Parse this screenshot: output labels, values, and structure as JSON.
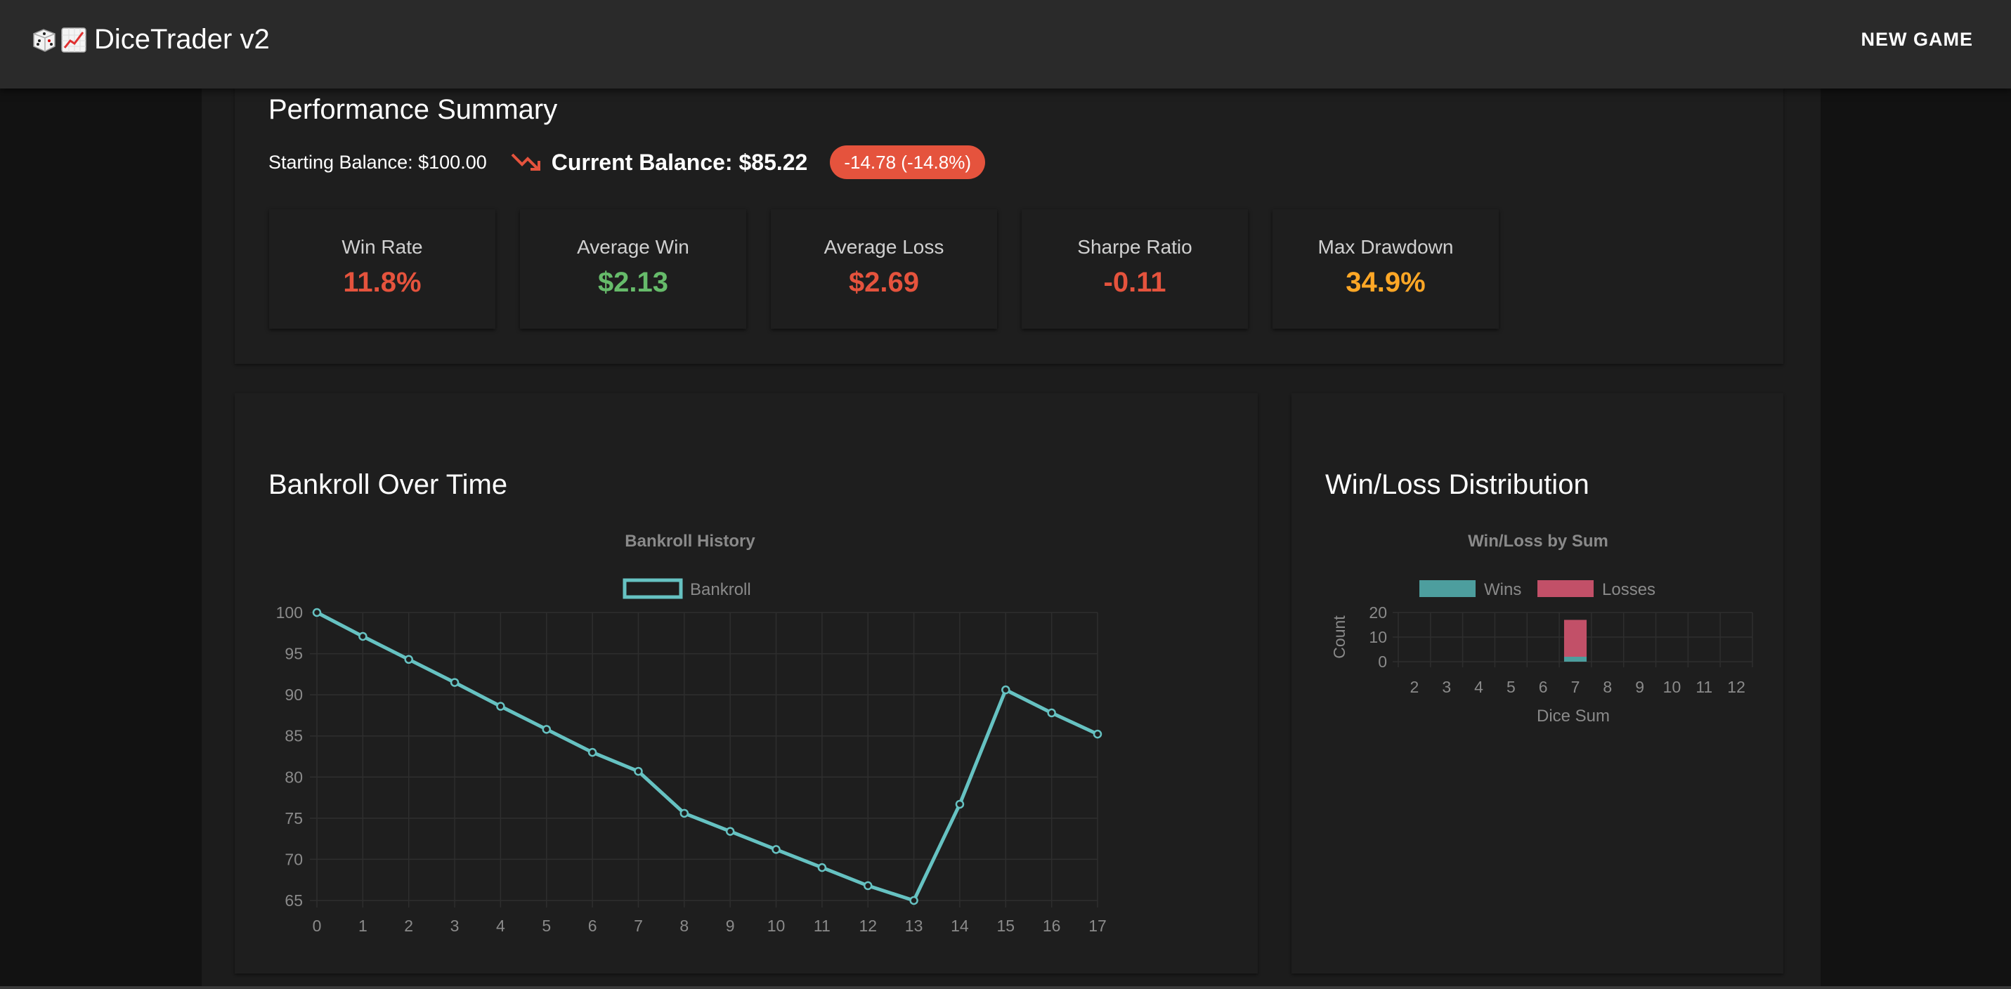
{
  "app": {
    "title": "DiceTrader v2",
    "new_game_label": "NEW GAME"
  },
  "summary": {
    "title": "Performance Summary",
    "starting_balance": "Starting Balance: $100.00",
    "current_balance": "Current Balance: $85.22",
    "change_chip": "-14.78 (-14.8%)",
    "chip_color": "#e5533d",
    "trend_icon": "trending-down-icon"
  },
  "stats": [
    {
      "label": "Win Rate",
      "value": "11.8%",
      "color": "#e5533d"
    },
    {
      "label": "Average Win",
      "value": "$2.13",
      "color": "#66bb6a"
    },
    {
      "label": "Average Loss",
      "value": "$2.69",
      "color": "#e5533d"
    },
    {
      "label": "Sharpe Ratio",
      "value": "-0.11",
      "color": "#e5533d"
    },
    {
      "label": "Max Drawdown",
      "value": "34.9%",
      "color": "#ffa726"
    }
  ],
  "bankroll_panel": {
    "title": "Bankroll Over Time"
  },
  "distribution_panel": {
    "title": "Win/Loss Distribution"
  },
  "chart_data": [
    {
      "type": "line",
      "title": "Bankroll History",
      "series": [
        {
          "name": "Bankroll",
          "color": "#66c2c2",
          "x": [
            0,
            1,
            2,
            3,
            4,
            5,
            6,
            7,
            8,
            9,
            10,
            11,
            12,
            13,
            14,
            15,
            16,
            17
          ],
          "values": [
            100,
            97.1,
            94.3,
            91.5,
            88.6,
            85.8,
            83.0,
            80.7,
            75.6,
            73.4,
            71.2,
            69.0,
            66.8,
            65.0,
            76.7,
            90.6,
            87.8,
            85.22
          ]
        }
      ],
      "xlabel": "",
      "ylabel": "",
      "xlim": [
        0,
        17
      ],
      "ylim": [
        65,
        100
      ],
      "yticks": [
        100,
        95,
        90,
        85,
        80,
        75,
        70,
        65
      ],
      "grid": true,
      "legend": "top"
    },
    {
      "type": "bar",
      "stacked": true,
      "title": "Win/Loss by Sum",
      "categories": [
        "2",
        "3",
        "4",
        "5",
        "6",
        "7",
        "8",
        "9",
        "10",
        "11",
        "12"
      ],
      "series": [
        {
          "name": "Wins",
          "color": "#4d9e9e",
          "values": [
            0,
            0,
            0,
            0,
            0,
            2,
            0,
            0,
            0,
            0,
            0
          ]
        },
        {
          "name": "Losses",
          "color": "#c25068",
          "values": [
            0,
            0,
            0,
            0,
            0,
            15,
            0,
            0,
            0,
            0,
            0
          ]
        }
      ],
      "xlabel": "Dice Sum",
      "ylabel": "Count",
      "ylim": [
        0,
        20
      ],
      "yticks": [
        20,
        10,
        0
      ],
      "grid": true,
      "legend": "top"
    }
  ]
}
